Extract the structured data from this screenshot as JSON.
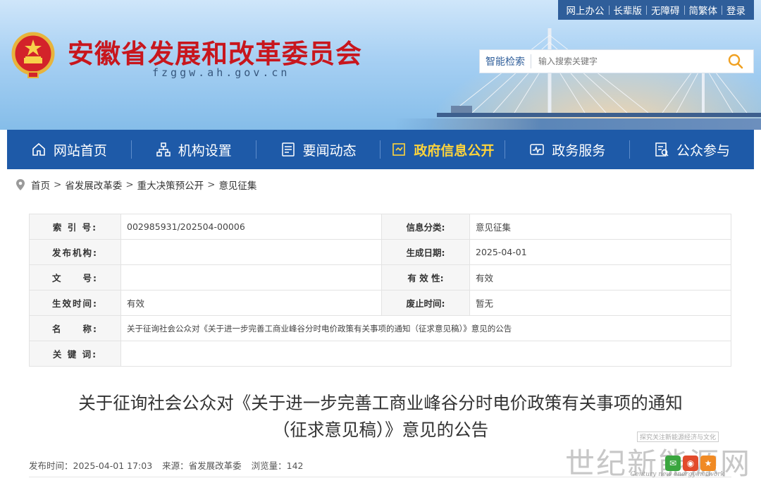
{
  "header": {
    "title": "安徽省发展和改革委员会",
    "domain": "fzggw.ah.gov.cn",
    "top_links": [
      "网上办公",
      "长辈版",
      "无障碍",
      "简繁体",
      "登录"
    ],
    "search": {
      "label": "智能检索",
      "placeholder": "输入搜索关键字"
    }
  },
  "nav": {
    "items": [
      {
        "label": "网站首页",
        "icon": "home-icon"
      },
      {
        "label": "机构设置",
        "icon": "org-chart-icon"
      },
      {
        "label": "要闻动态",
        "icon": "news-icon"
      },
      {
        "label": "政府信息公开",
        "icon": "info-disclosure-icon",
        "active": true
      },
      {
        "label": "政务服务",
        "icon": "service-icon"
      },
      {
        "label": "公众参与",
        "icon": "participation-icon"
      }
    ]
  },
  "breadcrumb": [
    "首页",
    "省发展改革委",
    "重大决策预公开",
    "意见征集"
  ],
  "info": {
    "index_no_label": "索 引 号:",
    "index_no": "002985931/202504-00006",
    "category_label": "信息分类:",
    "category": "意见征集",
    "publisher_label": "发布机构:",
    "publisher": "",
    "created_label": "生成日期:",
    "created": "2025-04-01",
    "doc_no_label": "文　　号:",
    "doc_no": "",
    "validity_label": "有 效 性:",
    "validity": "有效",
    "effective_label": "生效时间:",
    "effective": "有效",
    "expiry_label": "废止时间:",
    "expiry": "暂无",
    "name_label": "名　　称:",
    "name": "关于征询社会公众对《关于进一步完善工商业峰谷分时电价政策有关事项的通知（征求意见稿）》意见的公告",
    "keywords_label": "关 键 词:",
    "keywords": ""
  },
  "article": {
    "title_line1": "关于征询社会公众对《关于进一步完善工商业峰谷分时电价政策有关事项的通知",
    "title_line2": "（征求意见稿）》意见的公告",
    "publish_time": "发布时间：2025-04-01 17:03",
    "source": "来源：省发展改革委",
    "views": "浏览量：142"
  },
  "watermark": {
    "slogan": "探究关注新能源经济与文化",
    "brand": "世纪新能源网",
    "english": "Century new energy network"
  },
  "colors": {
    "brand_red": "#c8161d",
    "nav_blue": "#1e5aa8",
    "nav_active": "#ffd43b",
    "topbar": "#2f5e9a"
  }
}
